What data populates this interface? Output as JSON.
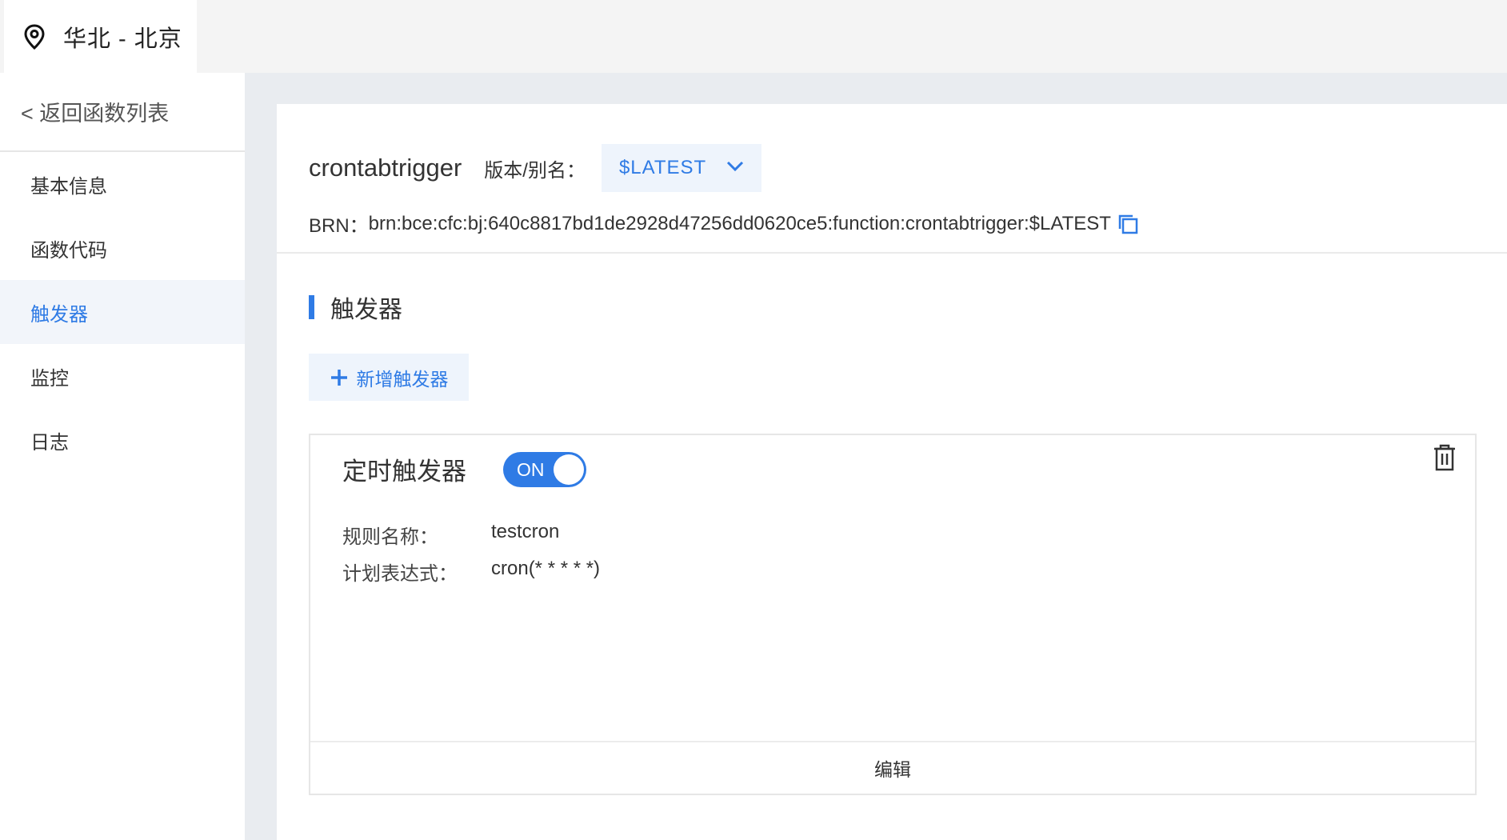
{
  "region": {
    "icon": "location-pin-icon",
    "label": "华北 - 北京"
  },
  "sidebar": {
    "back_label": "< 返回函数列表",
    "items": [
      {
        "label": "基本信息",
        "active": false
      },
      {
        "label": "函数代码",
        "active": false
      },
      {
        "label": "触发器",
        "active": true
      },
      {
        "label": "监控",
        "active": false
      },
      {
        "label": "日志",
        "active": false
      }
    ]
  },
  "header": {
    "function_name": "crontabtrigger",
    "version_label": "版本/别名：",
    "version_value": "$LATEST",
    "brn_label": "BRN：",
    "brn_value": "brn:bce:cfc:bj:640c8817bd1de2928d47256dd0620ce5:function:crontabtrigger:$LATEST"
  },
  "section": {
    "title": "触发器",
    "add_button": "新增触发器"
  },
  "trigger_card": {
    "title": "定时触发器",
    "toggle_label": "ON",
    "toggle_on": true,
    "fields": [
      {
        "key": "规则名称：",
        "value": "testcron"
      },
      {
        "key": "计划表达式：",
        "value": "cron(* * * * *)"
      }
    ],
    "edit_label": "编辑"
  },
  "colors": {
    "accent": "#2f7be5",
    "accent_bg": "#eef4fc",
    "active_bg": "#f2f5fa"
  }
}
